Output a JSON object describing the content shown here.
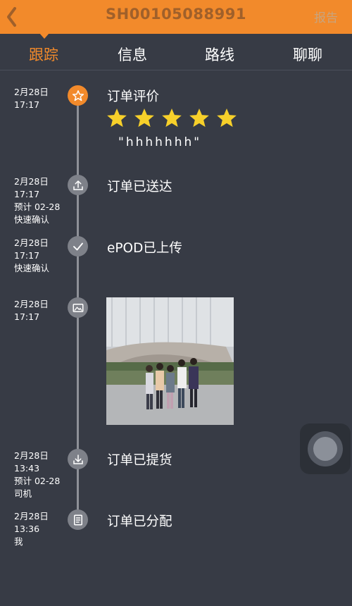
{
  "header": {
    "title": "SH00105088991",
    "report_label": "报告"
  },
  "tabs": [
    {
      "label": "跟踪",
      "active": true
    },
    {
      "label": "信息",
      "active": false
    },
    {
      "label": "路线",
      "active": false
    },
    {
      "label": "聊聊",
      "active": false
    }
  ],
  "events": [
    {
      "date": "2月28日",
      "time": "17:17",
      "meta1": "",
      "meta2": "",
      "title": "订单评价",
      "icon": "star-icon"
    },
    {
      "date": "2月28日",
      "time": "17:17",
      "meta1": "预计 02-28",
      "meta2": "快速确认",
      "title": "订单已送达",
      "icon": "upload-icon"
    },
    {
      "date": "2月28日",
      "time": "17:17",
      "meta1": "快速确认",
      "meta2": "",
      "title": "ePOD已上传",
      "icon": "check-icon"
    },
    {
      "date": "2月28日",
      "time": "17:17",
      "meta1": "",
      "meta2": "",
      "title": "",
      "icon": "image-icon"
    },
    {
      "date": "2月28日",
      "time": "13:43",
      "meta1": "预计 02-28",
      "meta2": "司机",
      "title": "订单已提货",
      "icon": "download-icon"
    },
    {
      "date": "2月28日",
      "time": "13:36",
      "meta1": "我",
      "meta2": "",
      "title": "订单已分配",
      "icon": "document-icon"
    }
  ],
  "rating": {
    "stars": 5,
    "max": 5,
    "comment": "\"hhhhhhh\""
  },
  "colors": {
    "accent": "#f28a2b",
    "background": "#373b45",
    "star": "#f7d02a"
  }
}
